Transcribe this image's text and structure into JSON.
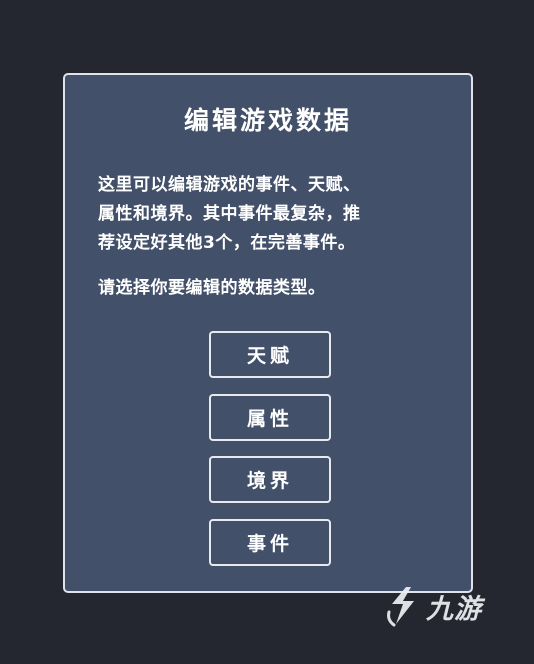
{
  "dialog": {
    "title": "编辑游戏数据",
    "description_lines": [
      "这里可以编辑游戏的事件、天赋、",
      "属性和境界。其中事件最复杂，推",
      "荐设定好其他3个，在完善事件。"
    ],
    "prompt": "请选择你要编辑的数据类型。",
    "buttons": {
      "talent": "天赋",
      "attribute": "属性",
      "realm": "境界",
      "event": "事件"
    }
  },
  "watermark": {
    "icon": "jiuyou-logo-icon",
    "text": "九游"
  },
  "colors": {
    "background": "#24272f",
    "dialog": "#435069",
    "border": "#dfe3ea",
    "text": "#ffffff"
  }
}
